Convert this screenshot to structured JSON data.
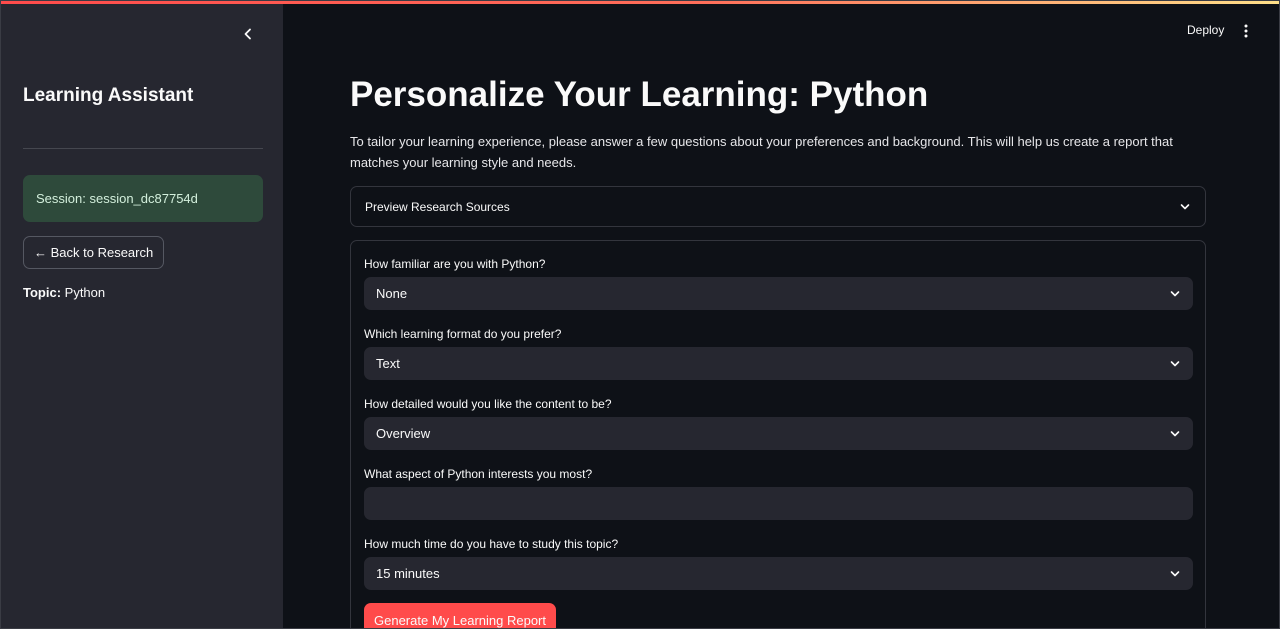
{
  "sidebar": {
    "title": "Learning Assistant",
    "session_text": "Session: session_dc87754d",
    "back_button": "← Back to Research",
    "topic_label": "Topic:",
    "topic_value": " Python"
  },
  "header": {
    "deploy_label": "Deploy",
    "menu_icon": "more-vertical-icon"
  },
  "main": {
    "title": "Personalize Your Learning: Python",
    "intro": "To tailor your learning experience, please answer a few questions about your preferences and background. This will help us create a report that matches your learning style and needs.",
    "expander_label": "Preview Research Sources",
    "questions": [
      {
        "label": "How familiar are you with Python?",
        "value": "None"
      },
      {
        "label": "Which learning format do you prefer?",
        "value": "Text"
      },
      {
        "label": "How detailed would you like the content to be?",
        "value": "Overview"
      },
      {
        "label": "What aspect of Python interests you most?",
        "value": ""
      },
      {
        "label": "How much time do you have to study this topic?",
        "value": "15 minutes"
      }
    ],
    "submit_label": "Generate My Learning Report"
  },
  "colors": {
    "background": "#0e1117",
    "sidebar": "#262730",
    "accent": "#ff4b4b",
    "session_box": "#2e4a3b"
  }
}
